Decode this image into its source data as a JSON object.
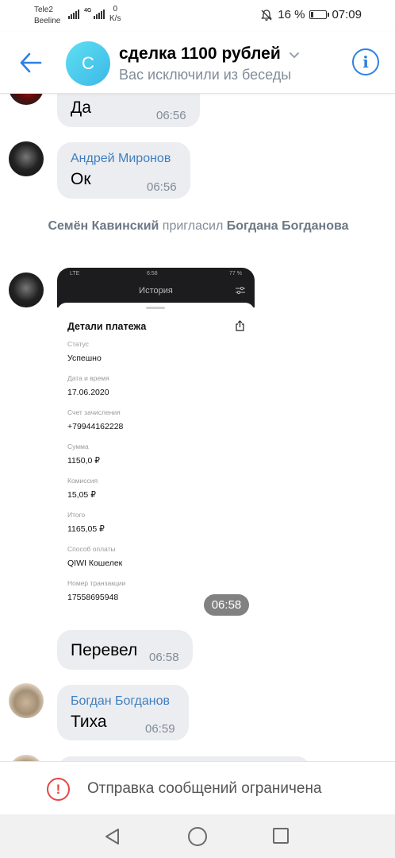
{
  "status_bar": {
    "carrier1": "Tele2",
    "carrier2": "Beeline",
    "network": "4G",
    "speed_value": "0",
    "speed_unit": "K/s",
    "battery": "16 %",
    "battery_level": 0.16,
    "time": "07:09"
  },
  "header": {
    "avatar_letter": "С",
    "title": "сделка 1100 рублей",
    "subtitle": "Вас исключили из беседы",
    "accent": "#2d81e0"
  },
  "messages": {
    "m1": {
      "text": "Да",
      "time": "06:56"
    },
    "m2": {
      "sender": "Андрей Миронов",
      "text": "Ок",
      "time": "06:56"
    },
    "service": {
      "actor": "Семён Кавинский",
      "action": " пригласил ",
      "target": "Богдана Богданова"
    },
    "m3": {
      "time": "06:58"
    },
    "m4": {
      "text": "Перевел",
      "time": "06:58"
    },
    "m5": {
      "sender": "Богдан Богданов",
      "text": "Тиха",
      "time": "06:59"
    }
  },
  "attachment": {
    "status_left": "LTE",
    "status_time": "6:58",
    "status_right": "77 %",
    "screen_title": "История",
    "sheet_title": "Детали платежа",
    "fields": [
      {
        "label": "Статус",
        "value": "Успешно"
      },
      {
        "label": "Дата и время",
        "value": "17.06.2020"
      },
      {
        "label": "Счет зачисления",
        "value": "+79944162228"
      },
      {
        "label": "Сумма",
        "value": "1150,0 ₽"
      },
      {
        "label": "Комиссия",
        "value": "15,05 ₽"
      },
      {
        "label": "Итого",
        "value": "1165,05 ₽"
      },
      {
        "label": "Способ оплаты",
        "value": "QIWI Кошелек"
      },
      {
        "label": "Номер транзакции",
        "value": "17558695948"
      }
    ]
  },
  "footer": {
    "restricted_text": "Отправка сообщений ограничена"
  }
}
